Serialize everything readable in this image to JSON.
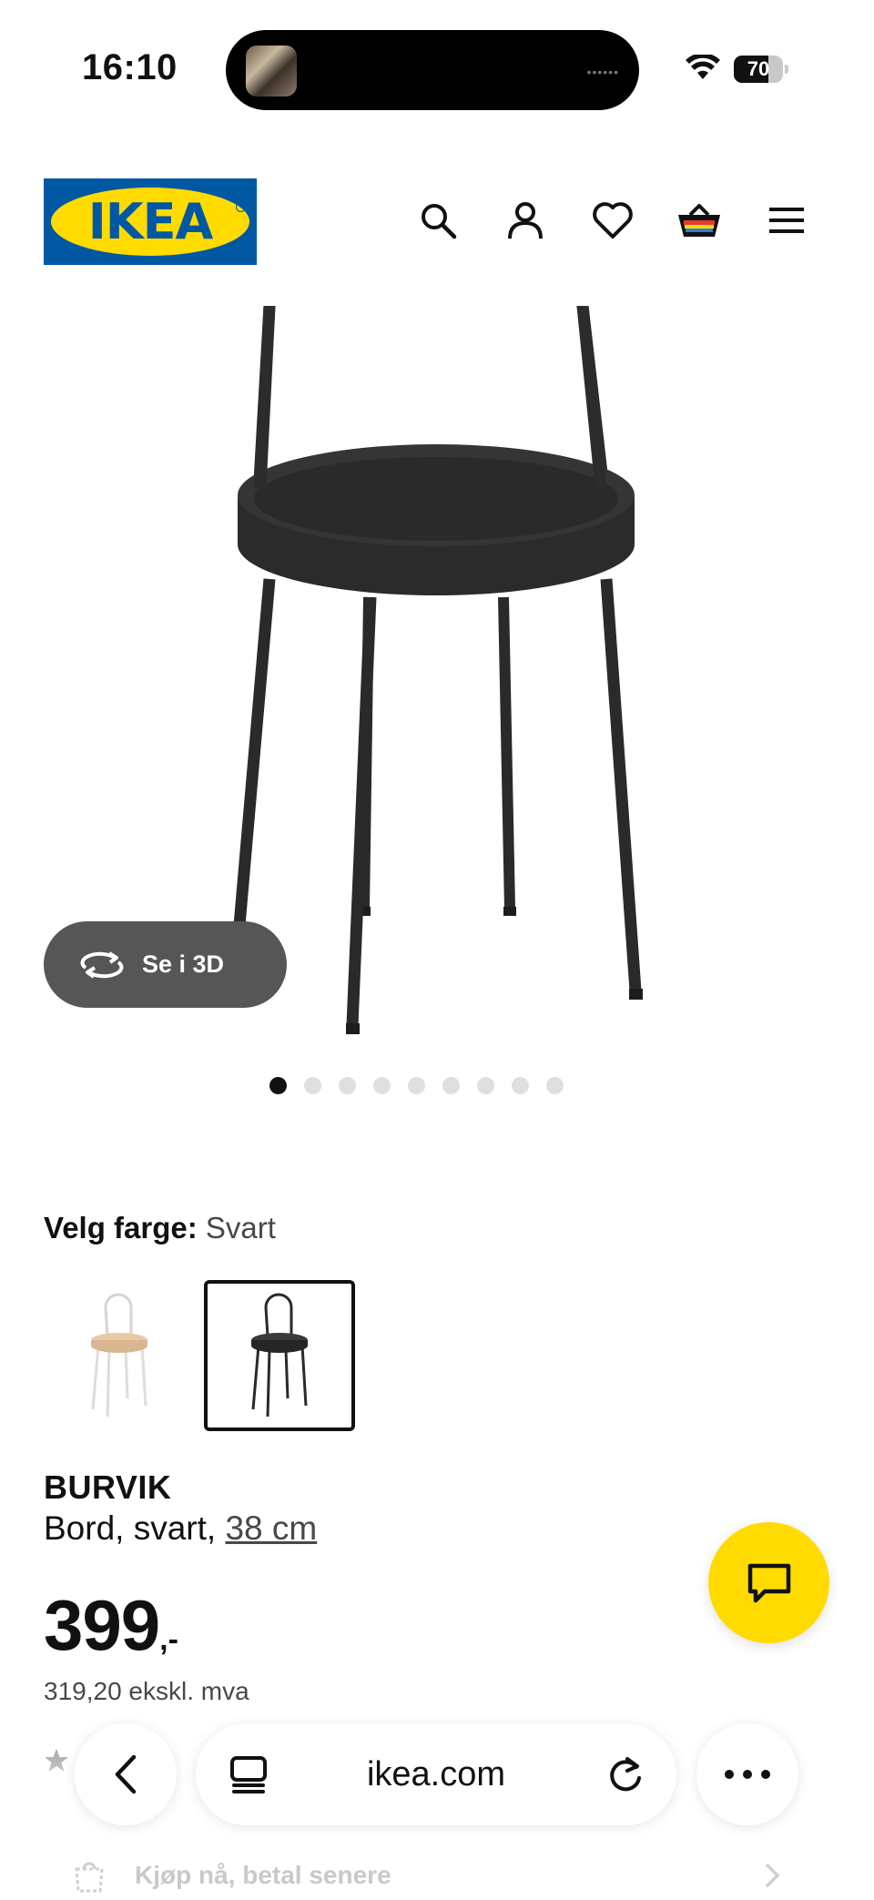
{
  "status_bar": {
    "time": "16:10",
    "battery_level": 70,
    "battery_label": "70"
  },
  "header": {
    "logo_text": "IKEA",
    "icons": [
      "search-icon",
      "account-icon",
      "heart-icon",
      "basket-icon",
      "menu-icon"
    ]
  },
  "product_image": {
    "see_in_3d_label": "Se i 3D",
    "carousel_total": 9,
    "carousel_active_index": 0
  },
  "color_selector": {
    "label": "Velg farge:",
    "selected_value": "Svart",
    "options": [
      {
        "name": "birch-white",
        "selected": false
      },
      {
        "name": "black",
        "selected": true
      }
    ]
  },
  "product": {
    "name": "BURVIK",
    "description_prefix": "Bord, svart, ",
    "size_link": "38 cm",
    "price_main": "399",
    "price_suffix": ",-",
    "price_ex_vat": "319,20 ekskl. mva"
  },
  "payment": {
    "label": "Kjøp nå, betal senere"
  },
  "browser": {
    "url": "ikea.com"
  },
  "colors": {
    "ikea_blue": "#0058a3",
    "ikea_yellow": "#ffdb00",
    "product_black": "#2a2a2a",
    "button_grey": "#565656"
  }
}
